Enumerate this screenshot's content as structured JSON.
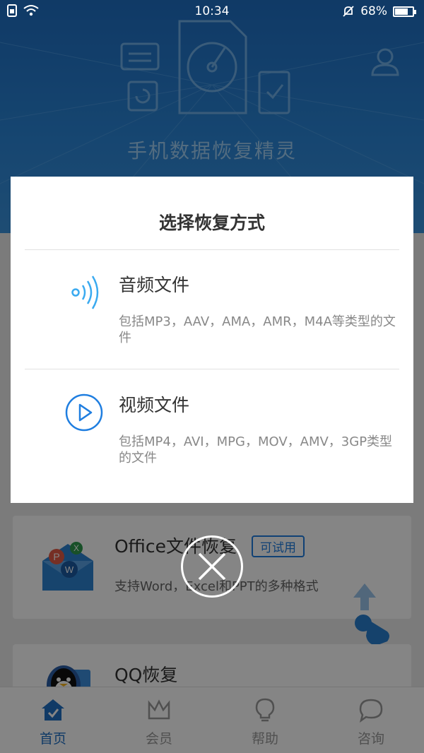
{
  "status_bar": {
    "time": "10:34",
    "battery_text": "68%",
    "battery_level": 0.68,
    "icons": [
      "sim-icon",
      "wifi-icon",
      "mute-icon",
      "battery-icon"
    ]
  },
  "app": {
    "title": "手机数据恢复精灵"
  },
  "cards": {
    "office": {
      "title": "Office文件恢复",
      "badge": "可试用",
      "desc": "支持Word，Excel和PPT的多种格式"
    },
    "qq": {
      "title": "QQ恢复"
    }
  },
  "tabbar": {
    "items": [
      {
        "label": "首页",
        "icon": "home-icon",
        "active": true
      },
      {
        "label": "会员",
        "icon": "crown-icon",
        "active": false
      },
      {
        "label": "帮助",
        "icon": "lightbulb-icon",
        "active": false
      },
      {
        "label": "咨询",
        "icon": "chat-icon",
        "active": false
      }
    ]
  },
  "dialog": {
    "title": "选择恢复方式",
    "options": [
      {
        "title": "音频文件",
        "desc": "包括MP3，AAV，AMA，AMR，M4A等类型的文件",
        "icon": "audio-wave-icon"
      },
      {
        "title": "视频文件",
        "desc": "包括MP4，AVI，MPG，MOV，AMV，3GP类型的文件",
        "icon": "play-circle-icon"
      }
    ],
    "close_icon": "close-icon"
  },
  "colors": {
    "accent": "#1f7ee0",
    "hero_top": "#1f6fc4",
    "audio_icon": "#3aaaf0"
  }
}
